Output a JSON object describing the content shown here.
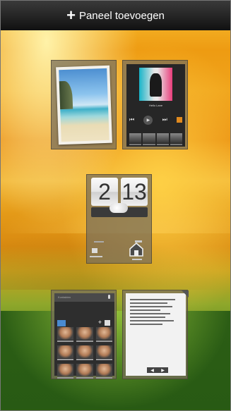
{
  "header": {
    "add_panel_label": "Paneel toevoegen",
    "add_icon": "plus-icon"
  },
  "clock_widget": {
    "hour": "2",
    "minute": "13"
  },
  "music_widget": {
    "track_title": "Hello Lane",
    "artist": "",
    "controls": [
      "previous-icon",
      "play-icon",
      "next-icon"
    ]
  },
  "people_widget": {
    "search_placeholder": "Kontakten"
  }
}
